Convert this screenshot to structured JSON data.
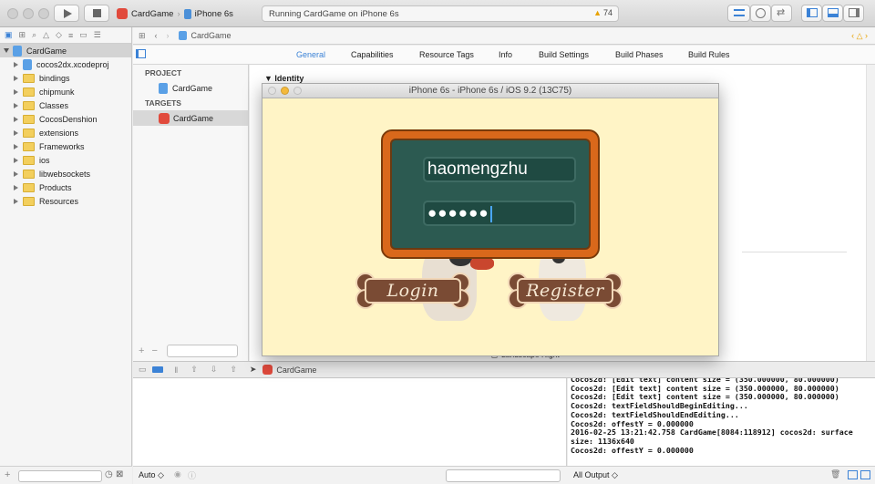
{
  "toolbar": {
    "scheme": "CardGame",
    "device": "iPhone 6s",
    "status": "Running CardGame on iPhone 6s",
    "warnings": "74"
  },
  "navigator": {
    "items": [
      {
        "label": "CardGame",
        "kind": "project",
        "level": 0
      },
      {
        "label": "cocos2dx.xcodeproj",
        "kind": "project",
        "level": 1
      },
      {
        "label": "bindings",
        "kind": "folder",
        "level": 1
      },
      {
        "label": "chipmunk",
        "kind": "folder",
        "level": 1
      },
      {
        "label": "Classes",
        "kind": "folder",
        "level": 1
      },
      {
        "label": "CocosDenshion",
        "kind": "folder",
        "level": 1
      },
      {
        "label": "extensions",
        "kind": "folder",
        "level": 1
      },
      {
        "label": "Frameworks",
        "kind": "folder",
        "level": 1
      },
      {
        "label": "ios",
        "kind": "folder",
        "level": 1
      },
      {
        "label": "libwebsockets",
        "kind": "folder",
        "level": 1
      },
      {
        "label": "Products",
        "kind": "folder",
        "level": 1
      },
      {
        "label": "Resources",
        "kind": "folder",
        "level": 1
      }
    ]
  },
  "jumpbar": {
    "file": "CardGame"
  },
  "tabs": [
    "General",
    "Capabilities",
    "Resource Tags",
    "Info",
    "Build Settings",
    "Build Phases",
    "Build Rules"
  ],
  "targets_pane": {
    "project_header": "PROJECT",
    "project_item": "CardGame",
    "targets_header": "TARGETS",
    "target_item": "CardGame"
  },
  "editor": {
    "section": "Identity",
    "partial": "Landscape Right"
  },
  "debugbar": {
    "target": "CardGame"
  },
  "console": {
    "lines": [
      "Cocos2d: [Edit text] content size = (350.000000, 80.000000)",
      "Cocos2d: [Edit text] content size = (350.000000, 80.000000)",
      "Cocos2d: [Edit text] content size = (350.000000, 80.000000)",
      "Cocos2d: textFieldShouldBeginEditing...",
      "Cocos2d: textFieldShouldEndEditing...",
      "Cocos2d: offestY = 0.000000",
      "2016-02-25 13:21:42.758 CardGame[8084:118912] cocos2d: surface size: 1136x640",
      "Cocos2d: offestY = 0.000000"
    ]
  },
  "bottombar": {
    "auto_label": "Auto ◇",
    "output_label": "All Output ◇"
  },
  "simulator": {
    "title": "iPhone 6s - iPhone 6s / iOS 9.2 (13C75)",
    "username": "haomengzhu",
    "password_mask": "●●●●●●",
    "login_label": "Login",
    "register_label": "Register"
  }
}
